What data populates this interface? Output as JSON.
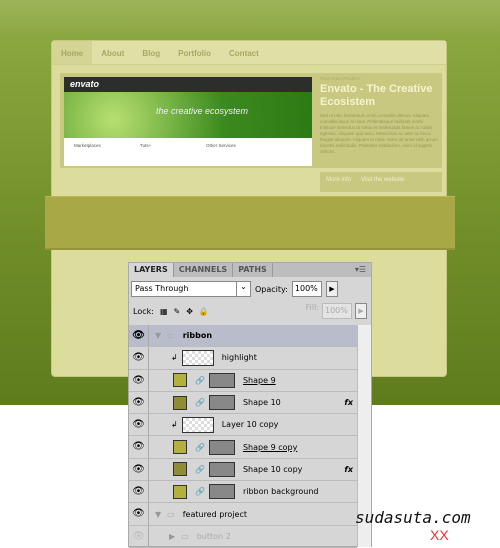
{
  "site": {
    "nav": [
      "Home",
      "About",
      "Blog",
      "Portfolio",
      "Contact"
    ],
    "screenshot": {
      "logo": "envato",
      "hero": "the creative ecosystem",
      "cols": [
        "Marketplaces",
        "Tuts+",
        "Other Services"
      ]
    },
    "featured": {
      "label": "FEATURED PROJECT",
      "title": "Envato - The Creative Ecosistem",
      "body": "Sed ut odio fermentum enim convallis ultrices. Aliquam convallis lacus at risus. Pellentesque habitant morbi tristique senectus et netus et malesuada fames ac turpis egestas. Aliquam quis arcu. Maecenas ac ante ac lacus feugiat aliquam. Aliquam et risus. Nunc sit amet nibh ipsum lobortis sollicitudin. Praesent vestibulum, enim id sagittis ultrices.",
      "more": "More info",
      "visit": "Visit the website"
    }
  },
  "panel": {
    "tabs": [
      "LAYERS",
      "CHANNELS",
      "PATHS"
    ],
    "blend": "Pass Through",
    "opacity_label": "Opacity:",
    "opacity": "100%",
    "lock_label": "Lock:",
    "fill_label": "Fill:",
    "fill": "100%",
    "layers": [
      {
        "name": "ribbon",
        "type": "group"
      },
      {
        "name": "highlight",
        "type": "clip"
      },
      {
        "name": "Shape 9",
        "type": "shape",
        "color": "#b4b040",
        "underline": true
      },
      {
        "name": "Shape 10",
        "type": "shape",
        "color": "#8e8c34",
        "fx": "fx"
      },
      {
        "name": "Layer 10 copy",
        "type": "clip"
      },
      {
        "name": "Shape 9 copy",
        "type": "shape",
        "color": "#b4b040",
        "underline": true
      },
      {
        "name": "Shape 10 copy",
        "type": "shape",
        "color": "#8e8c34",
        "fx": "fx"
      },
      {
        "name": "ribbon background",
        "type": "shape",
        "color": "#b4b040"
      },
      {
        "name": "featured project",
        "type": "group2"
      },
      {
        "name": "button 2",
        "type": "faded"
      }
    ]
  },
  "watermark": "sudasuta.com",
  "watermark_mark": "XX"
}
